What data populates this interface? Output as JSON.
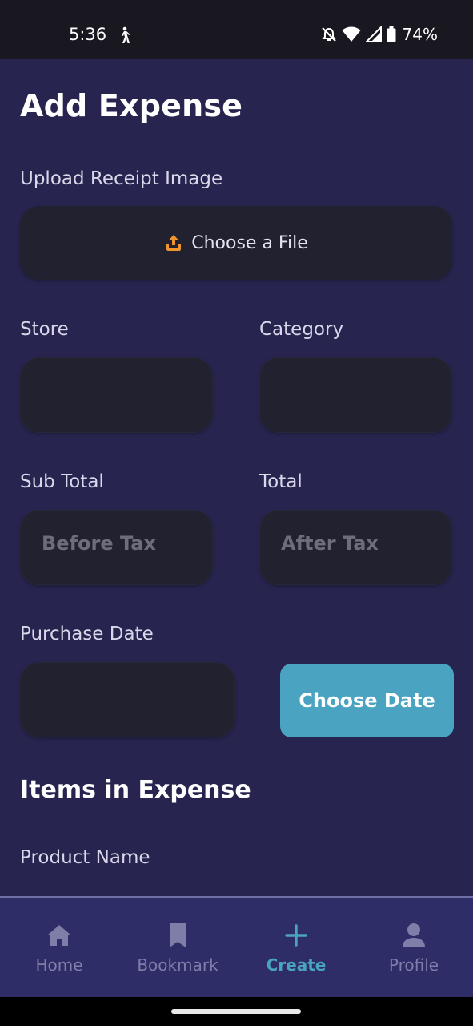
{
  "status_bar": {
    "time": "5:36",
    "battery": "74%"
  },
  "page": {
    "title": "Add Expense"
  },
  "form": {
    "upload_label": "Upload Receipt Image",
    "upload_button": "Choose a File",
    "store_label": "Store",
    "store_value": "",
    "category_label": "Category",
    "category_value": "",
    "subtotal_label": "Sub Total",
    "subtotal_placeholder": "Before Tax",
    "total_label": "Total",
    "total_placeholder": "After Tax",
    "purchase_date_label": "Purchase Date",
    "purchase_date_value": "",
    "choose_date_button": "Choose Date",
    "items_title": "Items in Expense",
    "product_name_label": "Product Name"
  },
  "nav": {
    "items": [
      {
        "label": "Home",
        "icon": "home-icon",
        "active": false
      },
      {
        "label": "Bookmark",
        "icon": "bookmark-icon",
        "active": false
      },
      {
        "label": "Create",
        "icon": "plus-icon",
        "active": true
      },
      {
        "label": "Profile",
        "icon": "person-icon",
        "active": false
      }
    ]
  },
  "colors": {
    "background": "#27254f",
    "field": "#22212f",
    "accent": "#4aa3c0",
    "upload_icon": "#f0952d",
    "nav_bg": "#2f2d67",
    "nav_inactive": "#7f7ea8"
  }
}
